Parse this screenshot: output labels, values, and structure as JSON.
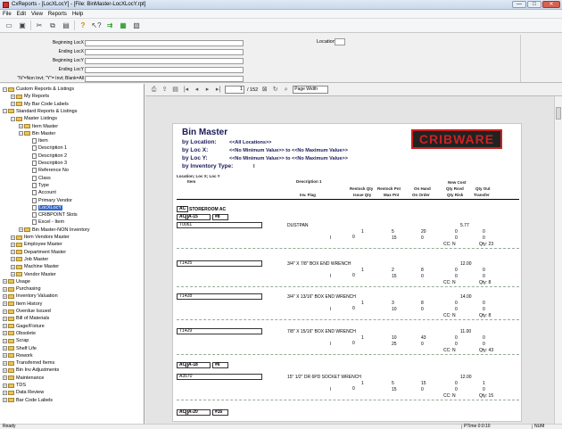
{
  "window": {
    "title": "CxReports - [LocXLocY] - [File: BinMaster-LocXLocY.rpt]",
    "controls": [
      "—",
      "□",
      "✕"
    ]
  },
  "menu": [
    "File",
    "Edit",
    "View",
    "Reports",
    "Help"
  ],
  "filters": {
    "beginning_locx": "Beginning LocX",
    "ending_locx": "Ending LocX",
    "beginning_locy": "Beginning LocY",
    "ending_locy": "Ending LocY",
    "inv_flag": "\"N\"=Non Invt; \"Y\"= Invt; Blank=All",
    "location": "Location"
  },
  "tree": [
    {
      "label": "Custom Reports & Listings",
      "level": 0,
      "exp": "−",
      "kind": "folder"
    },
    {
      "label": "My Reports",
      "level": 1,
      "exp": "+",
      "kind": "folder"
    },
    {
      "label": "My Bar Code Labels",
      "level": 1,
      "exp": "+",
      "kind": "folder"
    },
    {
      "label": "Standard Reports & Listings",
      "level": 0,
      "exp": "−",
      "kind": "folder"
    },
    {
      "label": "Master Listings",
      "level": 1,
      "exp": "−",
      "kind": "folder"
    },
    {
      "label": "Item Master",
      "level": 2,
      "exp": "+",
      "kind": "folder"
    },
    {
      "label": "Bin Master",
      "level": 2,
      "exp": "−",
      "kind": "folder"
    },
    {
      "label": "Item",
      "level": 3,
      "exp": "",
      "kind": "doc"
    },
    {
      "label": "Description 1",
      "level": 3,
      "exp": "",
      "kind": "doc"
    },
    {
      "label": "Description 2",
      "level": 3,
      "exp": "",
      "kind": "doc"
    },
    {
      "label": "Description 3",
      "level": 3,
      "exp": "",
      "kind": "doc"
    },
    {
      "label": "Reference No",
      "level": 3,
      "exp": "",
      "kind": "doc"
    },
    {
      "label": "Class",
      "level": 3,
      "exp": "",
      "kind": "doc"
    },
    {
      "label": "Type",
      "level": 3,
      "exp": "",
      "kind": "doc"
    },
    {
      "label": "Account",
      "level": 3,
      "exp": "",
      "kind": "doc"
    },
    {
      "label": "Primary Vendor",
      "level": 3,
      "exp": "",
      "kind": "doc"
    },
    {
      "label": "LocXLocY",
      "level": 3,
      "exp": "",
      "kind": "doc",
      "selected": true
    },
    {
      "label": "CRIBPOINT Slots",
      "level": 3,
      "exp": "",
      "kind": "doc"
    },
    {
      "label": "Excel - Item",
      "level": 3,
      "exp": "",
      "kind": "doc"
    },
    {
      "label": "Bin Master-NON Inventory",
      "level": 2,
      "exp": "+",
      "kind": "folder"
    },
    {
      "label": "Item Vendors Master",
      "level": 1,
      "exp": "+",
      "kind": "folder"
    },
    {
      "label": "Employee Master",
      "level": 1,
      "exp": "+",
      "kind": "folder"
    },
    {
      "label": "Department Master",
      "level": 1,
      "exp": "+",
      "kind": "folder"
    },
    {
      "label": "Job Master",
      "level": 1,
      "exp": "+",
      "kind": "folder"
    },
    {
      "label": "Machine Master",
      "level": 1,
      "exp": "+",
      "kind": "folder"
    },
    {
      "label": "Vendor Master",
      "level": 1,
      "exp": "+",
      "kind": "folder"
    },
    {
      "label": "Usage",
      "level": 0,
      "exp": "+",
      "kind": "folder"
    },
    {
      "label": "Purchasing",
      "level": 0,
      "exp": "+",
      "kind": "folder"
    },
    {
      "label": "Inventory Valuation",
      "level": 0,
      "exp": "+",
      "kind": "folder"
    },
    {
      "label": "Item History",
      "level": 0,
      "exp": "+",
      "kind": "folder"
    },
    {
      "label": "Overdue Issued",
      "level": 0,
      "exp": "+",
      "kind": "folder"
    },
    {
      "label": "Bill of Materials",
      "level": 0,
      "exp": "+",
      "kind": "folder"
    },
    {
      "label": "Gage/Fixture",
      "level": 0,
      "exp": "+",
      "kind": "folder"
    },
    {
      "label": "Obsolete",
      "level": 0,
      "exp": "+",
      "kind": "folder"
    },
    {
      "label": "Scrap",
      "level": 0,
      "exp": "+",
      "kind": "folder"
    },
    {
      "label": "Shelf Life",
      "level": 0,
      "exp": "+",
      "kind": "folder"
    },
    {
      "label": "Rework",
      "level": 0,
      "exp": "+",
      "kind": "folder"
    },
    {
      "label": "Transferred Items",
      "level": 0,
      "exp": "+",
      "kind": "folder"
    },
    {
      "label": "Bin Inv Adjustments",
      "level": 0,
      "exp": "+",
      "kind": "folder"
    },
    {
      "label": "Maintenance",
      "level": 0,
      "exp": "+",
      "kind": "folder"
    },
    {
      "label": "TDS",
      "level": 0,
      "exp": "+",
      "kind": "folder"
    },
    {
      "label": "Data Review",
      "level": 0,
      "exp": "+",
      "kind": "folder"
    },
    {
      "label": "Bar Code Labels",
      "level": 0,
      "exp": "+",
      "kind": "folder"
    }
  ],
  "viewer": {
    "page": "1",
    "page_total": "/ 152",
    "zoom": "Page Width"
  },
  "report": {
    "title": "Bin Master",
    "by_location_label": "by Location:",
    "by_location_value": "<<All Locations>>",
    "by_locx_label": "by Loc X:",
    "by_locx_value": "<<No Minimum Value>>  to  <<No Maximum Value>>",
    "by_locy_label": "by Loc Y:",
    "by_locy_value": "<<No Minimum Value>>  to  <<No Maximum Value>>",
    "by_invtype_label": "by Inventory Type:",
    "by_invtype_value": "I",
    "logo": "CRIBWARE",
    "group_header": "Location; Loc X; Loc Y",
    "col_item": "Item",
    "col_desc1": "Description 1",
    "col_invflag": "Inv. Flag",
    "col_restock_qty": "Restock Qty",
    "col_issue_qty": "Issue Qty",
    "col_restock_pnt": "Restock Pnt",
    "col_max_pnt": "Max Pnt",
    "col_on_hand": "On Hand",
    "col_on_order": "On Order",
    "col_new_cost": "New Cost",
    "col_qty_rsvd": "Qty Rsvd",
    "col_qty_risk": "Qty Risk",
    "col_qty_out": "Qty Out",
    "col_transfer": "Transfer",
    "loc1_tag": "AC",
    "loc1_name": "STOREROOM AC",
    "locx1_tag": "AC",
    "locx1_val": "A-15",
    "locy1_val": "#8",
    "locx2_tag": "AC",
    "locx2_val": "A-18",
    "locy2_val": "#6",
    "locx3_tag": "AC",
    "locx3_val": "A-20",
    "locy3_val": "#16",
    "items": [
      {
        "item": "T0061",
        "desc": "DUSTPAN",
        "flag": "I",
        "rq": "1",
        "iq": "0",
        "rp": "5",
        "mp": "15",
        "oh": "20",
        "oo": "0",
        "cost": "5.77",
        "rs": "0",
        "rk": "0",
        "qo": "0",
        "tr": "0",
        "cc": "CC: N",
        "qty": "Qty: 23"
      },
      {
        "item": "T1425",
        "desc": "3/4\" X 7/8\" BOX END WRENCH",
        "flag": "I",
        "rq": "1",
        "iq": "0",
        "rp": "2",
        "mp": "15",
        "oh": "8",
        "oo": "0",
        "cost": "12.00",
        "rs": "0",
        "rk": "0",
        "qo": "0",
        "tr": "0",
        "cc": "CC: N",
        "qty": "Qty: 8"
      },
      {
        "item": "T1428",
        "desc": "3/4\" X 13/16\" BOX END WRENCH",
        "flag": "I",
        "rq": "1",
        "iq": "0",
        "rp": "3",
        "mp": "10",
        "oh": "8",
        "oo": "0",
        "cost": "14.00",
        "rs": "0",
        "rk": "0",
        "qo": "0",
        "tr": "0",
        "cc": "CC: N",
        "qty": "Qty: 8"
      },
      {
        "item": "T1429",
        "desc": "7/8\" X 15/16\" BOX END WRENCH",
        "flag": "I",
        "rq": "1",
        "iq": "0",
        "rp": "10",
        "mp": "25",
        "oh": "43",
        "oo": "0",
        "cost": "11.00",
        "rs": "0",
        "rk": "0",
        "qo": "0",
        "tr": "0",
        "cc": "CC: N",
        "qty": "Qty: 43"
      },
      {
        "item": "A3570",
        "desc": "15\" 1/2\" DR 6PD SOCKET WRENCH",
        "flag": "I",
        "rq": "1",
        "iq": "0",
        "rp": "5",
        "mp": "15",
        "oh": "15",
        "oo": "0",
        "cost": "12.00",
        "rs": "0",
        "rk": "0",
        "qo": "1",
        "tr": "0",
        "cc": "CC: N",
        "qty": "Qty: 15"
      }
    ]
  },
  "status": {
    "ready": "Ready",
    "time": "PTime 0:0:10",
    "num": "NUM"
  }
}
